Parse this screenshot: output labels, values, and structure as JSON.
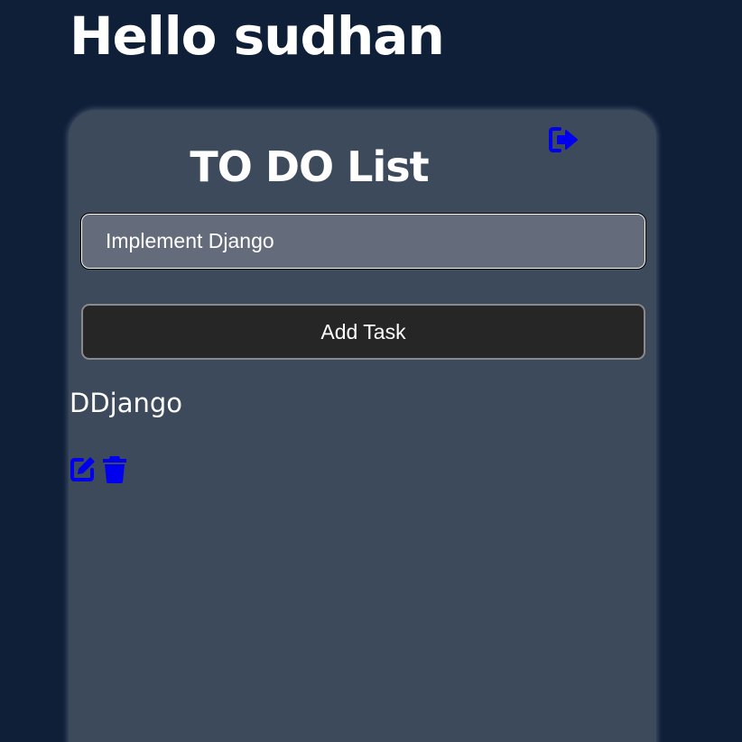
{
  "header": {
    "greeting": "Hello sudhan"
  },
  "todo": {
    "title": "TO DO List",
    "input_value": "Implement Django",
    "input_placeholder": "",
    "add_button_label": "Add Task",
    "logout_icon": "logout-icon"
  },
  "tasks": [
    {
      "text": "DDjango",
      "edit_icon": "edit-icon",
      "delete_icon": "trash-icon"
    }
  ],
  "colors": {
    "page_background": "#0f1f38",
    "card_background": "#3d4a5c",
    "input_background": "#646c7c",
    "button_background": "#262626",
    "icon_color": "#0000ee",
    "text_color": "#ffffff"
  }
}
